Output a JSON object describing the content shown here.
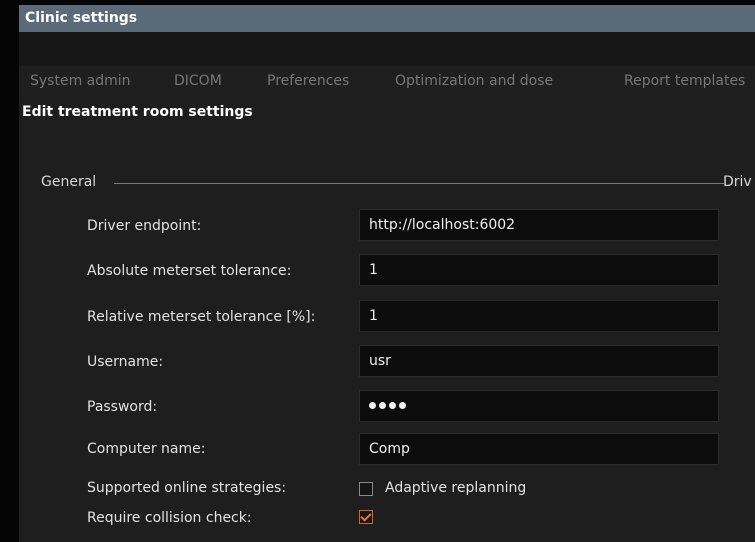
{
  "window": {
    "title": "Clinic settings"
  },
  "tabs": [
    {
      "label": "System admin"
    },
    {
      "label": "DICOM"
    },
    {
      "label": "Preferences"
    },
    {
      "label": "Optimization and dose"
    },
    {
      "label": "Report templates"
    }
  ],
  "page": {
    "title": "Edit treatment room settings"
  },
  "groups": {
    "general": "General",
    "driver": "Driv"
  },
  "fields": {
    "driver_endpoint": {
      "label": "Driver endpoint:",
      "value": "http://localhost:6002"
    },
    "absolute_tolerance": {
      "label": "Absolute meterset tolerance:",
      "value": "1"
    },
    "relative_tolerance": {
      "label": "Relative meterset tolerance [%]:",
      "value": "1"
    },
    "username": {
      "label": "Username:",
      "value": "usr"
    },
    "password": {
      "label": "Password:"
    },
    "computer_name": {
      "label": "Computer name:",
      "value": "Comp"
    },
    "online_strategies": {
      "label": "Supported online strategies:",
      "option": "Adaptive replanning",
      "checked": false
    },
    "collision_check": {
      "label": "Require collision check:",
      "checked": true
    }
  },
  "colors": {
    "titlebar": "#5b6a79",
    "background": "#1e1e1e",
    "input_background": "#0c0c0c",
    "accent_check": "#e07b1e"
  }
}
